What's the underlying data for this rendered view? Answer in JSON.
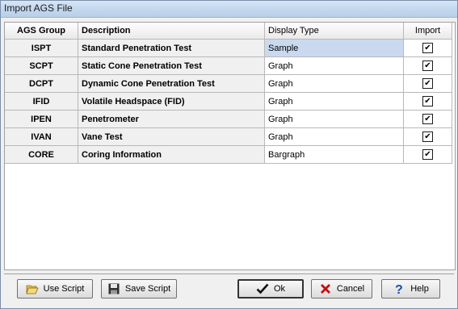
{
  "window": {
    "title": "Import AGS File"
  },
  "table": {
    "headers": {
      "group": "AGS Group",
      "description": "Description",
      "display_type": "Display Type",
      "import": "Import"
    },
    "rows": [
      {
        "group": "ISPT",
        "description": "Standard Penetration Test",
        "display_type": "Sample",
        "import": true,
        "selected": true
      },
      {
        "group": "SCPT",
        "description": "Static Cone Penetration Test",
        "display_type": "Graph",
        "import": true
      },
      {
        "group": "DCPT",
        "description": "Dynamic Cone Penetration Test",
        "display_type": "Graph",
        "import": true
      },
      {
        "group": "IFID",
        "description": "Volatile Headspace (FID)",
        "display_type": "Graph",
        "import": true
      },
      {
        "group": "IPEN",
        "description": "Penetrometer",
        "display_type": "Graph",
        "import": true
      },
      {
        "group": "IVAN",
        "description": "Vane Test",
        "display_type": "Graph",
        "import": true
      },
      {
        "group": "CORE",
        "description": "Coring Information",
        "display_type": "Bargraph",
        "import": true
      }
    ]
  },
  "buttons": {
    "use_script": "Use Script",
    "save_script": "Save Script",
    "ok": "Ok",
    "cancel": "Cancel",
    "help": "Help"
  },
  "icons": {
    "use_script": "open-folder-icon",
    "save_script": "floppy-disk-icon",
    "ok": "checkmark-icon",
    "cancel": "red-x-icon",
    "help": "question-mark-icon"
  },
  "colors": {
    "selected_cell": "#c9d9ef",
    "titlebar": "#c4d8ef"
  }
}
